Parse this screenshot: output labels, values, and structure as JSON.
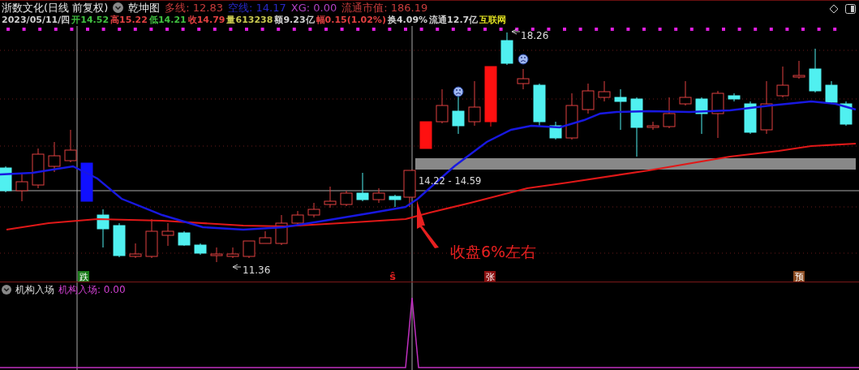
{
  "header": {
    "stock_name": "浙数文化(日线 前复权)",
    "indicator_name": "乾坤图",
    "indicators": [
      {
        "label": "多线: 12.83",
        "color": "#c83c3c"
      },
      {
        "label": "空线: 14.17",
        "color": "#2828c8"
      },
      {
        "label": "XG: 0.00",
        "color": "#b040c0"
      },
      {
        "label": "流通市值: 186.19",
        "color": "#c83c3c"
      }
    ],
    "quote": [
      {
        "text": "2023/05/11/四",
        "color": "#d0d0d0"
      },
      {
        "text": "开14.52",
        "color": "#40c040"
      },
      {
        "text": "高15.22",
        "color": "#e04040"
      },
      {
        "text": "低14.21",
        "color": "#40c040"
      },
      {
        "text": "收14.79",
        "color": "#e04040"
      },
      {
        "text": "量613238",
        "color": "#c8c850"
      },
      {
        "text": "额9.23亿",
        "color": "#d0d0d0"
      },
      {
        "text": "幅0.15(1.02%)",
        "color": "#e04040"
      },
      {
        "text": "换4.09%",
        "color": "#d0d0d0"
      },
      {
        "text": "流通12.7亿",
        "color": "#d0d0d0"
      },
      {
        "text": "互联网",
        "color": "#e0e020"
      }
    ]
  },
  "main_chart": {
    "high_label": "18.26",
    "low_label": "11.36",
    "range_label": "14.22 - 14.59",
    "annotation": "收盘6%左右",
    "signals": [
      {
        "text": "跌",
        "kind": "boxed",
        "color": "#1a7a1a"
      },
      {
        "text": "ŝ",
        "kind": "plain",
        "color": "#e02020"
      },
      {
        "text": "张",
        "kind": "boxed",
        "color": "#8a1010"
      },
      {
        "text": "预",
        "kind": "boxed",
        "color": "#8a4a20"
      }
    ]
  },
  "sub_indicator": {
    "name": "机构入场",
    "reading": "机构入场: 0.00"
  }
}
